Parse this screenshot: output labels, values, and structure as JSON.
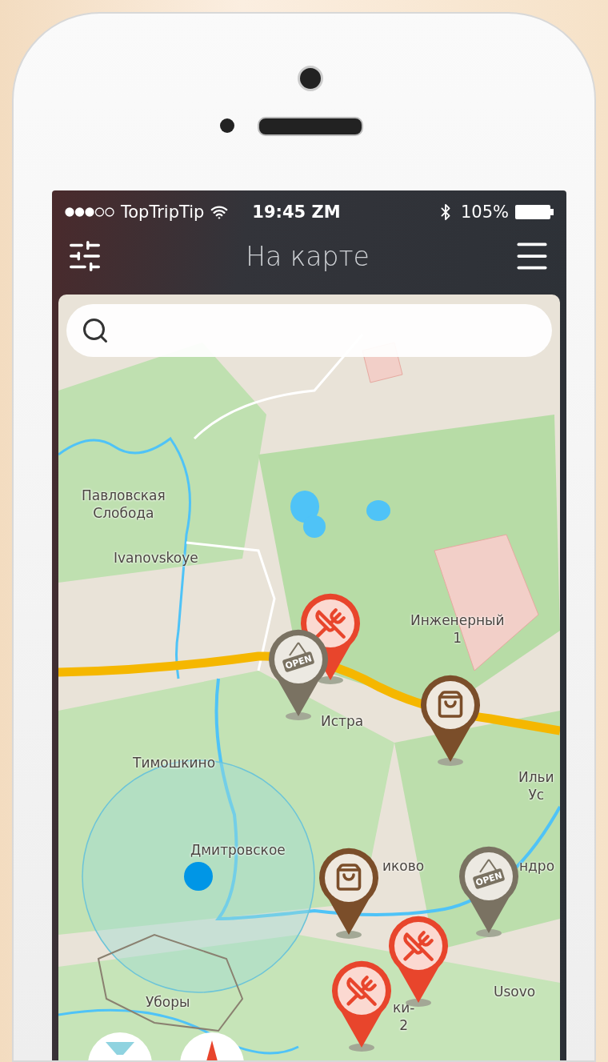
{
  "status_bar": {
    "carrier": "TopTripTip",
    "time": "19:45 ZM",
    "battery": "105%"
  },
  "nav_bar": {
    "title": "На карте"
  },
  "map": {
    "labels": [
      {
        "lines": [
          "Павловская",
          "Слобода"
        ]
      },
      {
        "lines": [
          "Ivanovskoye"
        ]
      },
      {
        "lines": [
          "Инженерный",
          "1"
        ]
      },
      {
        "lines": [
          "Истра"
        ]
      },
      {
        "lines": [
          "Тимошкино"
        ]
      },
      {
        "lines": [
          "Ильи",
          "Ус"
        ]
      },
      {
        "lines": [
          "Дмитровское"
        ]
      },
      {
        "lines": [
          "иково"
        ]
      },
      {
        "lines": [
          "ндро"
        ]
      },
      {
        "lines": [
          "Usovo"
        ]
      },
      {
        "lines": [
          "Уборы"
        ]
      },
      {
        "lines": [
          "ки-",
          "2"
        ]
      }
    ],
    "pins": [
      {
        "kind": "restaurant",
        "color": "#e8452c"
      },
      {
        "kind": "open",
        "color": "#7a7262",
        "sign_text": "OPEN"
      },
      {
        "kind": "shop",
        "color": "#7b4e2a"
      },
      {
        "kind": "shop",
        "color": "#7b4e2a"
      },
      {
        "kind": "open",
        "color": "#7a7262",
        "sign_text": "OPEN"
      },
      {
        "kind": "restaurant",
        "color": "#e8452c"
      },
      {
        "kind": "restaurant",
        "color": "#e8452c"
      }
    ]
  }
}
